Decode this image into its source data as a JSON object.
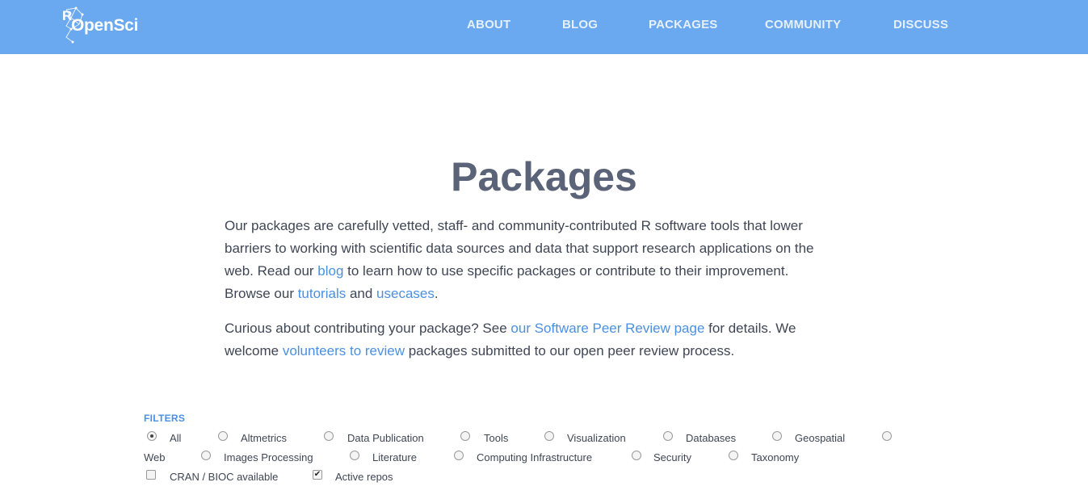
{
  "header": {
    "logo_r": "R",
    "logo_text": "OpenSci",
    "nav": [
      "ABOUT",
      "BLOG",
      "PACKAGES",
      "COMMUNITY",
      "DISCUSS"
    ],
    "bg_color": "#6aa8ef"
  },
  "main": {
    "title": "Packages",
    "p1": {
      "t1": "Our packages are carefully vetted, staff- and community-contributed R software tools that lower",
      "t2": "barriers to working with scientific data sources and data that support research applications on the",
      "t3a": "web. Read our ",
      "link_blog": "blog",
      "t3b": " to learn how to use specific packages or contribute to their improvement.",
      "t4a": "Browse our ",
      "link_tutorials": "tutorials",
      "t4b": " and ",
      "link_usecases": "usecases",
      "t4c": "."
    },
    "p2": {
      "t1a": "Curious about contributing your package? See ",
      "link_review": "our Software Peer Review page",
      "t1b": " for details. We",
      "t2a": "welcome ",
      "link_volunteers": "volunteers to review",
      "t2b": " packages submitted to our open peer review process."
    },
    "link_color": "#4a90e2"
  },
  "filters": {
    "label": "FILTERS",
    "options": [
      "All",
      "Altmetrics",
      "Data Publication",
      "Tools",
      "Visualization",
      "Databases",
      "Geospatial",
      "Web",
      "Images Processing",
      "Literature",
      "Computing Infrastructure",
      "Security",
      "Taxonomy"
    ],
    "selected": "All",
    "checkboxes": [
      {
        "label": "CRAN / BIOC available",
        "checked": false
      },
      {
        "label": "Active repos",
        "checked": true
      }
    ]
  }
}
